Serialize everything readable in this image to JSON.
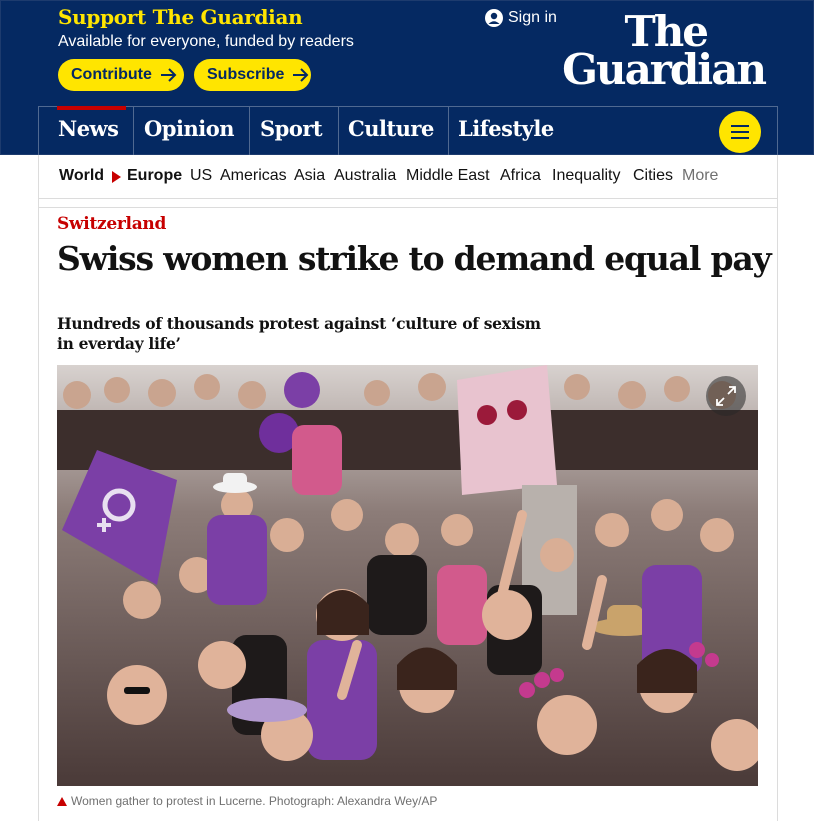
{
  "support": {
    "title": "Support The Guardian",
    "subtitle": "Available for everyone, funded by readers",
    "contribute_label": "Contribute",
    "subscribe_label": "Subscribe"
  },
  "account": {
    "sign_in_label": "Sign in"
  },
  "logo": {
    "line1": "The",
    "line2": "Guardian"
  },
  "pillars": [
    "News",
    "Opinion",
    "Sport",
    "Culture",
    "Lifestyle"
  ],
  "subnav": {
    "items": [
      "World",
      "Europe",
      "US",
      "Americas",
      "Asia",
      "Australia",
      "Middle East",
      "Africa",
      "Inequality",
      "Cities",
      "More"
    ]
  },
  "article": {
    "kicker": "Switzerland",
    "headline": "Swiss women strike to demand equal pay",
    "standfirst": "Hundreds of thousands protest against ‘culture of sexism in everday life’",
    "caption": "Women gather to protest in Lucerne. Photograph: Alexandra Wey/AP"
  },
  "icons": {
    "user": "user-icon",
    "arrow": "arrow-right-icon",
    "menu": "hamburger-icon",
    "expand": "expand-icon",
    "caption": "caption-triangle-icon",
    "breadcrumb": "breadcrumb-arrow-icon"
  },
  "colors": {
    "brand_blue": "#052962",
    "brand_yellow": "#ffe500",
    "news_red": "#c70000",
    "protest_purple": "#7b3fa6"
  }
}
